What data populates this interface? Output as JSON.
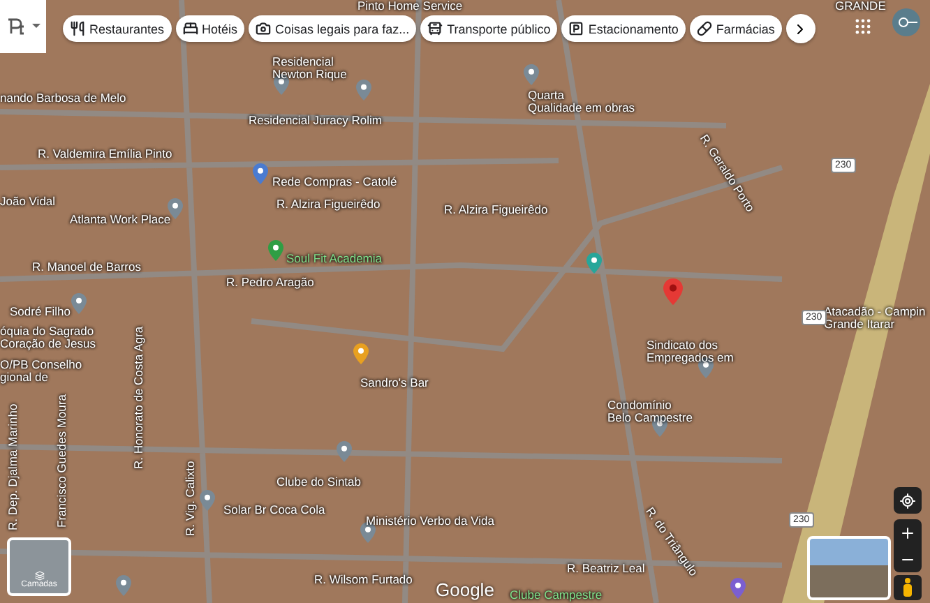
{
  "categories": [
    {
      "label": "Restaurantes",
      "kind": "restaurant"
    },
    {
      "label": "Hotéis",
      "kind": "hotel"
    },
    {
      "label": "Coisas legais para faz...",
      "kind": "camera"
    },
    {
      "label": "Transporte público",
      "kind": "transit"
    },
    {
      "label": "Estacionamento",
      "kind": "parking"
    },
    {
      "label": "Farmácias",
      "kind": "pharmacy"
    }
  ],
  "map": {
    "labels": [
      {
        "text": "Pinto Home Service",
        "kind": "place"
      },
      {
        "text": "GRANDE",
        "kind": "place"
      },
      {
        "text": "Residencial\nNewton Rique",
        "kind": "place"
      },
      {
        "text": "nando Barbosa de Melo",
        "kind": "street"
      },
      {
        "text": "Residencial Juracy Rolim",
        "kind": "place"
      },
      {
        "text": "Quarta\nQualidade em obras",
        "kind": "place"
      },
      {
        "text": "R. Valdemira Emília Pinto",
        "kind": "street"
      },
      {
        "text": "Rede Compras - Catolé",
        "kind": "place"
      },
      {
        "text": "João Vidal",
        "kind": "street"
      },
      {
        "text": "R. Alzira Figueirêdo",
        "kind": "street"
      },
      {
        "text": "R. Alzira Figueirêdo",
        "kind": "street"
      },
      {
        "text": "R. Geraldo Porto",
        "kind": "street"
      },
      {
        "text": "Atlanta Work Place",
        "kind": "place"
      },
      {
        "text": "R. Manoel de Barros",
        "kind": "street"
      },
      {
        "text": "Soul Fit Academia",
        "kind": "green"
      },
      {
        "text": "R. Pedro Aragão",
        "kind": "street"
      },
      {
        "text": "Sodré Filho",
        "kind": "street"
      },
      {
        "text": "óquia do Sagrado\nCoração de Jesus",
        "kind": "place"
      },
      {
        "text": "O/PB Conselho\ngional de",
        "kind": "place"
      },
      {
        "text": "Sindicato dos\nEmpregados em",
        "kind": "place"
      },
      {
        "text": "Atacadão - Campin\nGrande Itarar",
        "kind": "place"
      },
      {
        "text": "Sandro's Bar",
        "kind": "place"
      },
      {
        "text": "Condomínio\nBelo Campestre",
        "kind": "place"
      },
      {
        "text": "R. Dep. Djalma Marinho",
        "kind": "street"
      },
      {
        "text": "Francisco Guedes Moura",
        "kind": "street"
      },
      {
        "text": "R. Honorato de Costa Agra",
        "kind": "street"
      },
      {
        "text": "R. Vig. Calixto",
        "kind": "street"
      },
      {
        "text": "Clube do Sintab",
        "kind": "place"
      },
      {
        "text": "Solar Br Coca Cola",
        "kind": "place"
      },
      {
        "text": "Ministério Verbo da Vida",
        "kind": "place"
      },
      {
        "text": "R. do Triângulo",
        "kind": "street"
      },
      {
        "text": "R. Beatriz Leal",
        "kind": "street"
      },
      {
        "text": "R. Wilsom Furtado",
        "kind": "street"
      },
      {
        "text": "Clube Campestre",
        "kind": "green"
      }
    ],
    "route_shields": [
      "230",
      "230",
      "230"
    ]
  },
  "layers_button": {
    "label": "Camadas"
  },
  "attribution": "Google"
}
